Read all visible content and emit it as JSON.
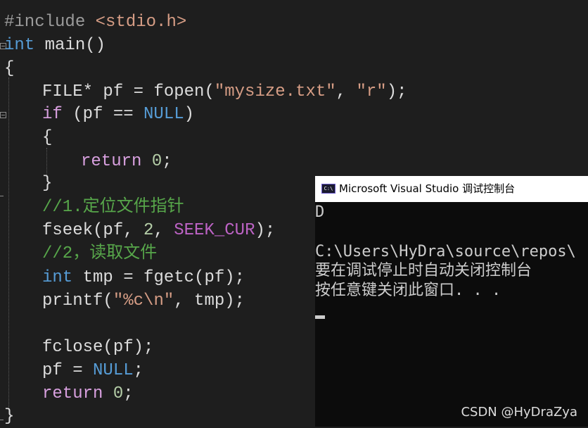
{
  "editor": {
    "lines": [
      [
        {
          "t": "#include ",
          "c": "tok-pre"
        },
        {
          "t": "<stdio.h>",
          "c": "tok-str"
        }
      ],
      [
        {
          "t": "int",
          "c": "tok-kw"
        },
        {
          "t": " main()",
          "c": "tok-id"
        }
      ],
      [
        {
          "t": "{",
          "c": "tok-id"
        }
      ],
      [
        {
          "t": "FILE* pf = fopen(",
          "c": "tok-id"
        },
        {
          "t": "\"mysize.txt\"",
          "c": "tok-str"
        },
        {
          "t": ", ",
          "c": "tok-id"
        },
        {
          "t": "\"r\"",
          "c": "tok-str"
        },
        {
          "t": ");",
          "c": "tok-id"
        }
      ],
      [
        {
          "t": "if",
          "c": "tok-ctl"
        },
        {
          "t": " (pf == ",
          "c": "tok-id"
        },
        {
          "t": "NULL",
          "c": "tok-kw"
        },
        {
          "t": ")",
          "c": "tok-id"
        }
      ],
      [
        {
          "t": "{",
          "c": "tok-id"
        }
      ],
      [
        {
          "t": "return",
          "c": "tok-ctl"
        },
        {
          "t": " ",
          "c": "tok-id"
        },
        {
          "t": "0",
          "c": "tok-num"
        },
        {
          "t": ";",
          "c": "tok-id"
        }
      ],
      [
        {
          "t": "}",
          "c": "tok-id"
        }
      ],
      [
        {
          "t": "//1.定位文件指针",
          "c": "tok-com"
        }
      ],
      [
        {
          "t": "fseek(pf, ",
          "c": "tok-id"
        },
        {
          "t": "2",
          "c": "tok-num"
        },
        {
          "t": ", ",
          "c": "tok-id"
        },
        {
          "t": "SEEK_CUR",
          "c": "tok-mac"
        },
        {
          "t": ");",
          "c": "tok-id"
        }
      ],
      [
        {
          "t": "//2，读取文件",
          "c": "tok-com"
        }
      ],
      [
        {
          "t": "int",
          "c": "tok-kw"
        },
        {
          "t": " tmp = fgetc(pf);",
          "c": "tok-id"
        }
      ],
      [
        {
          "t": "printf(",
          "c": "tok-id"
        },
        {
          "t": "\"%c\\n\"",
          "c": "tok-str"
        },
        {
          "t": ", tmp);",
          "c": "tok-id"
        }
      ],
      [],
      [
        {
          "t": "fclose(pf);",
          "c": "tok-id"
        }
      ],
      [
        {
          "t": "pf = ",
          "c": "tok-id"
        },
        {
          "t": "NULL",
          "c": "tok-kw"
        },
        {
          "t": ";",
          "c": "tok-id"
        }
      ],
      [
        {
          "t": "return",
          "c": "tok-ctl"
        },
        {
          "t": " ",
          "c": "tok-id"
        },
        {
          "t": "0",
          "c": "tok-num"
        },
        {
          "t": ";",
          "c": "tok-id"
        }
      ],
      [
        {
          "t": "}",
          "c": "tok-id"
        }
      ]
    ]
  },
  "console": {
    "title": "Microsoft Visual Studio 调试控制台",
    "icon_text": "C:\\",
    "output_lines": [
      "D",
      "",
      "C:\\Users\\HyDra\\source\\repos\\",
      "要在调试停止时自动关闭控制台",
      "按任意键关闭此窗口. . ."
    ]
  },
  "watermark": "CSDN @HyDraZya"
}
